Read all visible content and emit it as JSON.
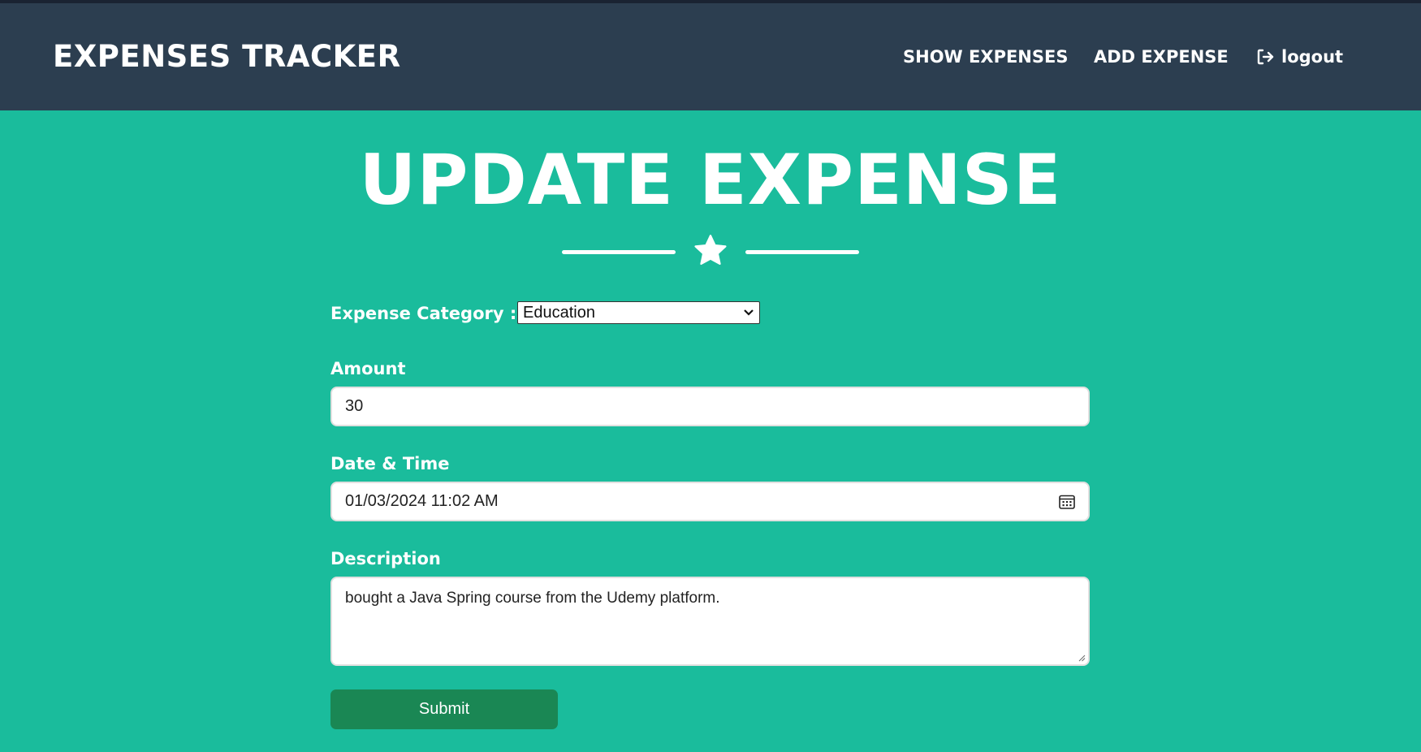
{
  "navbar": {
    "brand": "EXPENSES TRACKER",
    "items": [
      {
        "label": "SHOW EXPENSES"
      },
      {
        "label": "ADD EXPENSE"
      },
      {
        "label": "logout",
        "icon": "logout-icon"
      }
    ]
  },
  "page": {
    "title": "UPDATE EXPENSE",
    "divider_icon": "star-icon"
  },
  "form": {
    "category_label": "Expense Category :",
    "category_value": "Education",
    "amount_label": "Amount",
    "amount_value": "30",
    "datetime_label": "Date & Time",
    "datetime_value": "01/03/2024 11:02 AM",
    "description_label": "Description",
    "description_value": "bought a Java Spring course from the Udemy platform.",
    "submit_label": "Submit"
  },
  "colors": {
    "background": "#1abc9c",
    "navbar": "#2c3e50",
    "submit": "#1a8754"
  }
}
